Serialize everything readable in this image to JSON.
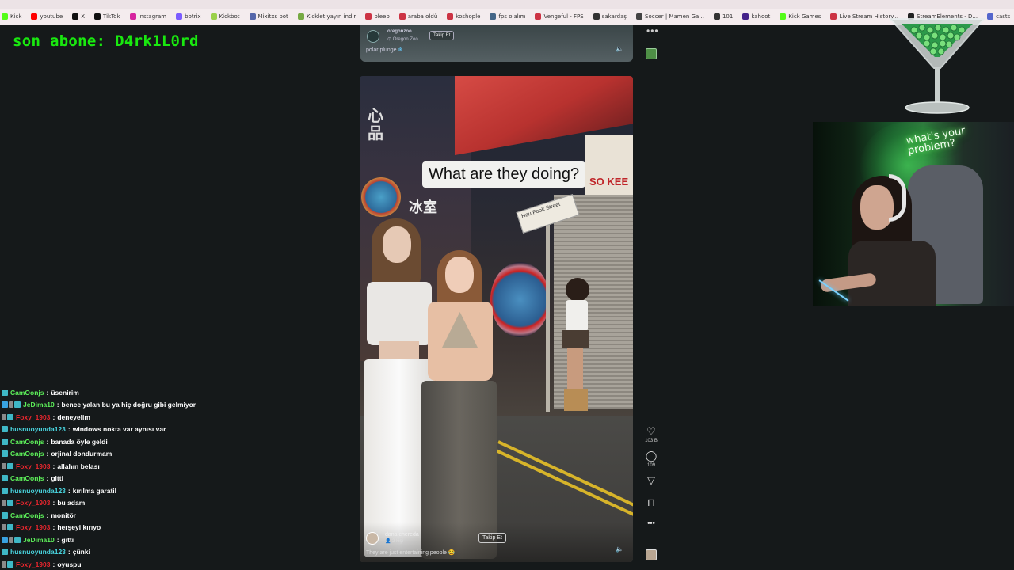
{
  "bookmarks": [
    {
      "label": "Kick",
      "color": "#53fc18"
    },
    {
      "label": "youtube",
      "color": "#ff0000"
    },
    {
      "label": "X",
      "color": "#111111"
    },
    {
      "label": "TikTok",
      "color": "#111111"
    },
    {
      "label": "Instagram",
      "color": "#d6249f"
    },
    {
      "label": "botrix",
      "color": "#7b5cff"
    },
    {
      "label": "Kickbot",
      "color": "#9bd14b"
    },
    {
      "label": "Mixitxs bot",
      "color": "#5566aa"
    },
    {
      "label": "Kicklet yayın indir",
      "color": "#77aa44"
    },
    {
      "label": "bleep",
      "color": "#cc3344"
    },
    {
      "label": "araba oldü",
      "color": "#cc3344"
    },
    {
      "label": "koshople",
      "color": "#cc3344"
    },
    {
      "label": "fps olalım",
      "color": "#446688"
    },
    {
      "label": "Vengeful - FPS",
      "color": "#cc3344"
    },
    {
      "label": "sakardaş",
      "color": "#333333"
    },
    {
      "label": "Soccer | Mamen Ga...",
      "color": "#444444"
    },
    {
      "label": "101",
      "color": "#333333"
    },
    {
      "label": "kahoot",
      "color": "#44228a"
    },
    {
      "label": "Kick Games",
      "color": "#53fc18"
    },
    {
      "label": "Live Stream History...",
      "color": "#cc3344"
    },
    {
      "label": "StreamElements - D...",
      "color": "#222222"
    },
    {
      "label": "casts",
      "color": "#5566cc"
    }
  ],
  "sub_alert": "son abone: D4rk1L0rd",
  "top_video": {
    "username": "oregonzoo",
    "location": "Oregon Zoo",
    "follow_label": "Takip Et",
    "caption": "polar plunge"
  },
  "main_video": {
    "overlay_text": "What are they doing?",
    "street_sign": "Hau Fook Street",
    "shop_sign": "SO KEE",
    "username": "dana.chereda",
    "sub_text": "2 kişi",
    "follow_label": "Takip Et",
    "description": "They are just entertaining people"
  },
  "actions": {
    "like_count": "103 B",
    "comment_count": "109"
  },
  "webcam": {
    "neon_sign": "what's your problem?"
  },
  "chat": [
    {
      "user": "CamOonjs",
      "color": "#5df05a",
      "text": "üsenirim",
      "badges": [
        "sub"
      ]
    },
    {
      "user": "JeDima10",
      "color": "#5df05a",
      "text": "bence yalan bu ya hiç doğru gibi gelmiyor",
      "badges": [
        "mod",
        "grey-small",
        "sub"
      ]
    },
    {
      "user": "Foxy_1903",
      "color": "#e8262e",
      "text": "deneyelim",
      "badges": [
        "grey-small",
        "sub"
      ]
    },
    {
      "user": "husnuoyunda123",
      "color": "#49d6e0",
      "text": "windows nokta var aynısı var",
      "badges": [
        "sub"
      ]
    },
    {
      "user": "CamOonjs",
      "color": "#5df05a",
      "text": "banada öyle geldi",
      "badges": [
        "sub"
      ]
    },
    {
      "user": "CamOonjs",
      "color": "#5df05a",
      "text": "orjinal dondurmam",
      "badges": [
        "sub"
      ]
    },
    {
      "user": "Foxy_1903",
      "color": "#e8262e",
      "text": "allahın belası",
      "badges": [
        "grey-small",
        "sub"
      ]
    },
    {
      "user": "CamOonjs",
      "color": "#5df05a",
      "text": "gitti",
      "badges": [
        "sub"
      ]
    },
    {
      "user": "husnuoyunda123",
      "color": "#49d6e0",
      "text": "kırılma garatil",
      "badges": [
        "sub"
      ]
    },
    {
      "user": "Foxy_1903",
      "color": "#e8262e",
      "text": "bu adam",
      "badges": [
        "grey-small",
        "sub"
      ]
    },
    {
      "user": "CamOonjs",
      "color": "#5df05a",
      "text": "monitör",
      "badges": [
        "sub"
      ]
    },
    {
      "user": "Foxy_1903",
      "color": "#e8262e",
      "text": "herşeyi kırıyo",
      "badges": [
        "grey-small",
        "sub"
      ]
    },
    {
      "user": "JeDima10",
      "color": "#5df05a",
      "text": "gitti",
      "badges": [
        "mod",
        "grey-small",
        "sub"
      ]
    },
    {
      "user": "husnuoyunda123",
      "color": "#49d6e0",
      "text": "çünki",
      "badges": [
        "sub"
      ]
    },
    {
      "user": "Foxy_1903",
      "color": "#e8262e",
      "text": "oyuspu",
      "badges": [
        "grey-small",
        "sub"
      ]
    }
  ]
}
